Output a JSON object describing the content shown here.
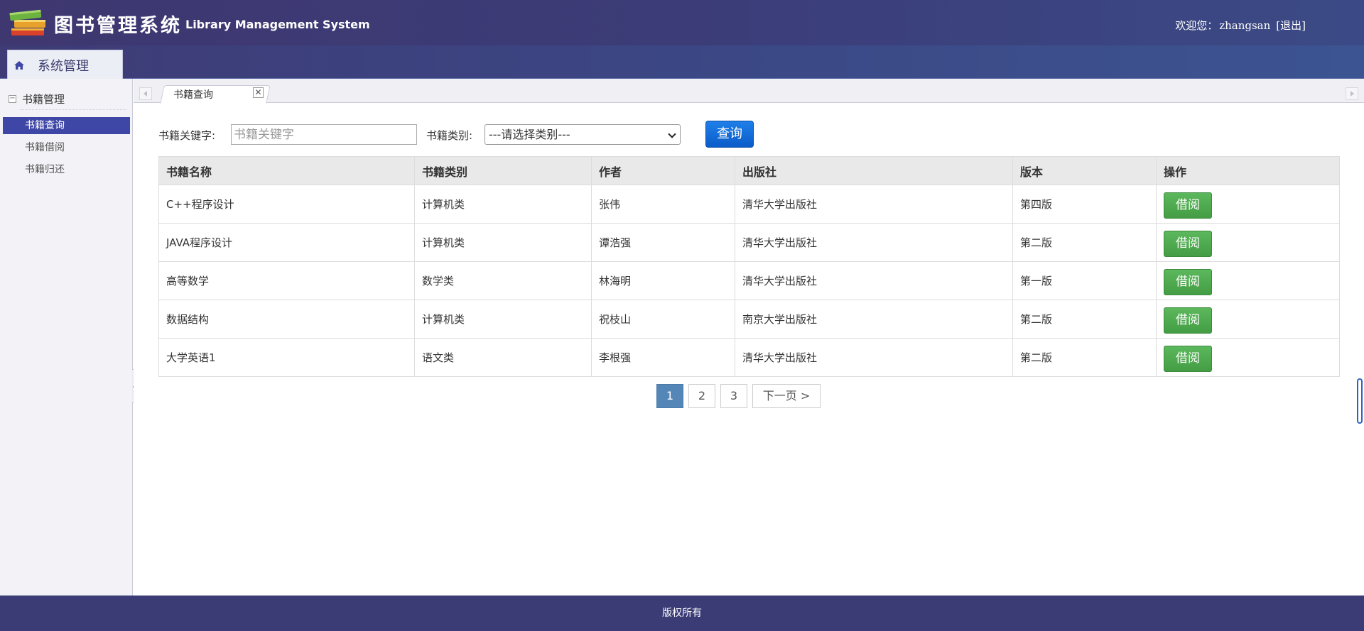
{
  "header": {
    "title": "图书管理系统",
    "subtitle": "Library Management System",
    "welcome_prefix": "欢迎您：",
    "username": "zhangsan",
    "logout": "[退出]"
  },
  "nav": {
    "tab_label": "系统管理"
  },
  "sidebar": {
    "group_label": "书籍管理",
    "items": [
      {
        "label": "书籍查询",
        "active": true
      },
      {
        "label": "书籍借阅",
        "active": false
      },
      {
        "label": "书籍归还",
        "active": false
      }
    ]
  },
  "tabs": [
    {
      "label": "书籍查询",
      "close": "✕"
    }
  ],
  "search": {
    "keyword_label": "书籍关键字:",
    "keyword_value": "",
    "keyword_placeholder": "书籍关键字",
    "category_label": "书籍类别:",
    "category_selected": "---请选择类别---",
    "query_button": "查询"
  },
  "table": {
    "columns": [
      "书籍名称",
      "书籍类别",
      "作者",
      "出版社",
      "版本",
      "操作"
    ],
    "rows": [
      {
        "name": "C++程序设计",
        "category": "计算机类",
        "author": "张伟",
        "publisher": "清华大学出版社",
        "edition": "第四版",
        "action": "借阅"
      },
      {
        "name": "JAVA程序设计",
        "category": "计算机类",
        "author": "谭浩强",
        "publisher": "清华大学出版社",
        "edition": "第二版",
        "action": "借阅"
      },
      {
        "name": "高等数学",
        "category": "数学类",
        "author": "林海明",
        "publisher": "清华大学出版社",
        "edition": "第一版",
        "action": "借阅"
      },
      {
        "name": "数据结构",
        "category": "计算机类",
        "author": "祝枝山",
        "publisher": "南京大学出版社",
        "edition": "第二版",
        "action": "借阅"
      },
      {
        "name": "大学英语1",
        "category": "语文类",
        "author": "李根强",
        "publisher": "清华大学出版社",
        "edition": "第二版",
        "action": "借阅"
      }
    ]
  },
  "pagination": {
    "pages": [
      "1",
      "2",
      "3"
    ],
    "current": "1",
    "next": "下一页 >"
  },
  "footer": {
    "text": "版权所有"
  },
  "colors": {
    "header_bg": "#3f3770",
    "sidebar_active": "#3f47a6",
    "query_button": "#0a5cc9",
    "borrow_button": "#449d44",
    "page_active": "#5486b7",
    "footer_bg": "#3b3b76"
  }
}
